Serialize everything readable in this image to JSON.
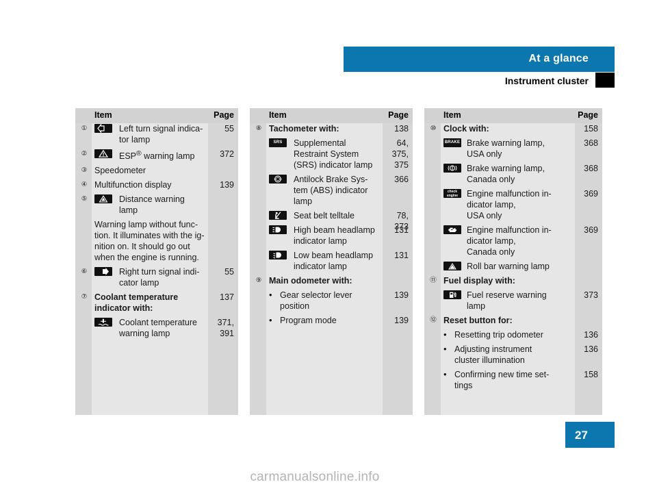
{
  "header": {
    "title": "At a glance",
    "subtitle": "Instrument cluster"
  },
  "page_number": "27",
  "watermark": "carmanualsonline.info",
  "table_headers": {
    "item": "Item",
    "page": "Page"
  },
  "columns": [
    {
      "id": "column-1",
      "rows": [
        {
          "num": "①",
          "icon": "left-turn-arrow-icon",
          "label": "Left turn signal indica-\ntor lamp",
          "page": "55"
        },
        {
          "num": "②",
          "icon": "warning-triangle-icon",
          "label": "ESP® warning lamp",
          "page": "372",
          "html_label": "ESP<sup>®</sup> warning lamp"
        },
        {
          "num": "③",
          "icon": null,
          "label": "Speedometer",
          "page": ""
        },
        {
          "num": "④",
          "icon": null,
          "label": "Multifunction display",
          "page": "139"
        },
        {
          "num": "⑤",
          "icon": "distance-warning-icon",
          "label": "Distance warning\nlamp",
          "page": ""
        },
        {
          "num": "",
          "icon": null,
          "label": "Warning lamp without func-\ntion. It illuminates with the ig-\nnition on. It should go out\nwhen the engine is running.",
          "page": "",
          "free": true
        },
        {
          "num": "⑥",
          "icon": "right-turn-arrow-icon",
          "label": "Right turn signal indi-\ncator lamp",
          "page": "55"
        },
        {
          "num": "⑦",
          "icon": null,
          "label": "Coolant temperature\nindicator with:",
          "page": "137",
          "bold": true
        },
        {
          "num": "",
          "icon": "coolant-temp-icon",
          "label": "Coolant temperature\nwarning lamp",
          "page": "371,\n391"
        }
      ]
    },
    {
      "id": "column-2",
      "rows": [
        {
          "num": "⑧",
          "icon": null,
          "label": "Tachometer with:",
          "page": "138",
          "bold": true
        },
        {
          "num": "",
          "icon": "srs-icon",
          "label": "Supplemental\nRestraint System\n(SRS) indicator lamp",
          "page": "64,\n375,\n375"
        },
        {
          "num": "",
          "icon": "abs-icon",
          "label": "Antilock Brake Sys-\ntem (ABS) indicator\nlamp",
          "page": "366"
        },
        {
          "num": "",
          "icon": "seat-belt-icon",
          "label": "Seat belt telltale",
          "page": "78,\n373"
        },
        {
          "num": "",
          "icon": "high-beam-icon",
          "label": "High beam headlamp\nindicator lamp",
          "page": "131"
        },
        {
          "num": "",
          "icon": "low-beam-icon",
          "label": "Low beam headlamp\nindicator lamp",
          "page": "131"
        },
        {
          "num": "⑨",
          "icon": null,
          "label": "Main odometer with:",
          "page": "",
          "bold": true
        },
        {
          "num": "",
          "icon": null,
          "bullet": true,
          "label": "Gear selector lever\nposition",
          "page": "139"
        },
        {
          "num": "",
          "icon": null,
          "bullet": true,
          "label": "Program mode",
          "page": "139"
        }
      ]
    },
    {
      "id": "column-3",
      "rows": [
        {
          "num": "⑩",
          "icon": null,
          "label": "Clock with:",
          "page": "158",
          "bold": true
        },
        {
          "num": "",
          "icon": "brake-text-icon",
          "label": "Brake warning lamp,\nUSA only",
          "page": "368"
        },
        {
          "num": "",
          "icon": "brake-circle-icon",
          "label": "Brake warning lamp,\nCanada only",
          "page": "368"
        },
        {
          "num": "",
          "icon": "check-engine-text-icon",
          "label": "Engine malfunction in-\ndicator lamp,\nUSA only",
          "page": "369"
        },
        {
          "num": "",
          "icon": "engine-outline-icon",
          "label": "Engine malfunction in-\ndicator lamp,\nCanada only",
          "page": "369"
        },
        {
          "num": "",
          "icon": "roll-bar-icon",
          "label": "Roll bar warning lamp",
          "page": ""
        },
        {
          "num": "⑪",
          "icon": null,
          "label": "Fuel display with:",
          "page": "",
          "bold": true
        },
        {
          "num": "",
          "icon": "fuel-pump-icon",
          "label": "Fuel reserve warning\nlamp",
          "page": "373"
        },
        {
          "num": "⑫",
          "icon": null,
          "label": "Reset button for:",
          "page": "",
          "bold": true
        },
        {
          "num": "",
          "icon": null,
          "bullet": true,
          "label": "Resetting trip odometer",
          "page": "136"
        },
        {
          "num": "",
          "icon": null,
          "bullet": true,
          "label": "Adjusting instrument\ncluster illumination",
          "page": "136"
        },
        {
          "num": "",
          "icon": null,
          "bullet": true,
          "label": "Confirming new time set-\ntings",
          "page": "158"
        }
      ]
    }
  ],
  "colors": {
    "accent_blue": "#0b77ae",
    "table_bg": "#e6e6e6",
    "table_strip": "#d6d6d6",
    "table_header": "#d2d2d2",
    "icon_black": "#111111",
    "watermark_gray": "#b4b4b4"
  }
}
